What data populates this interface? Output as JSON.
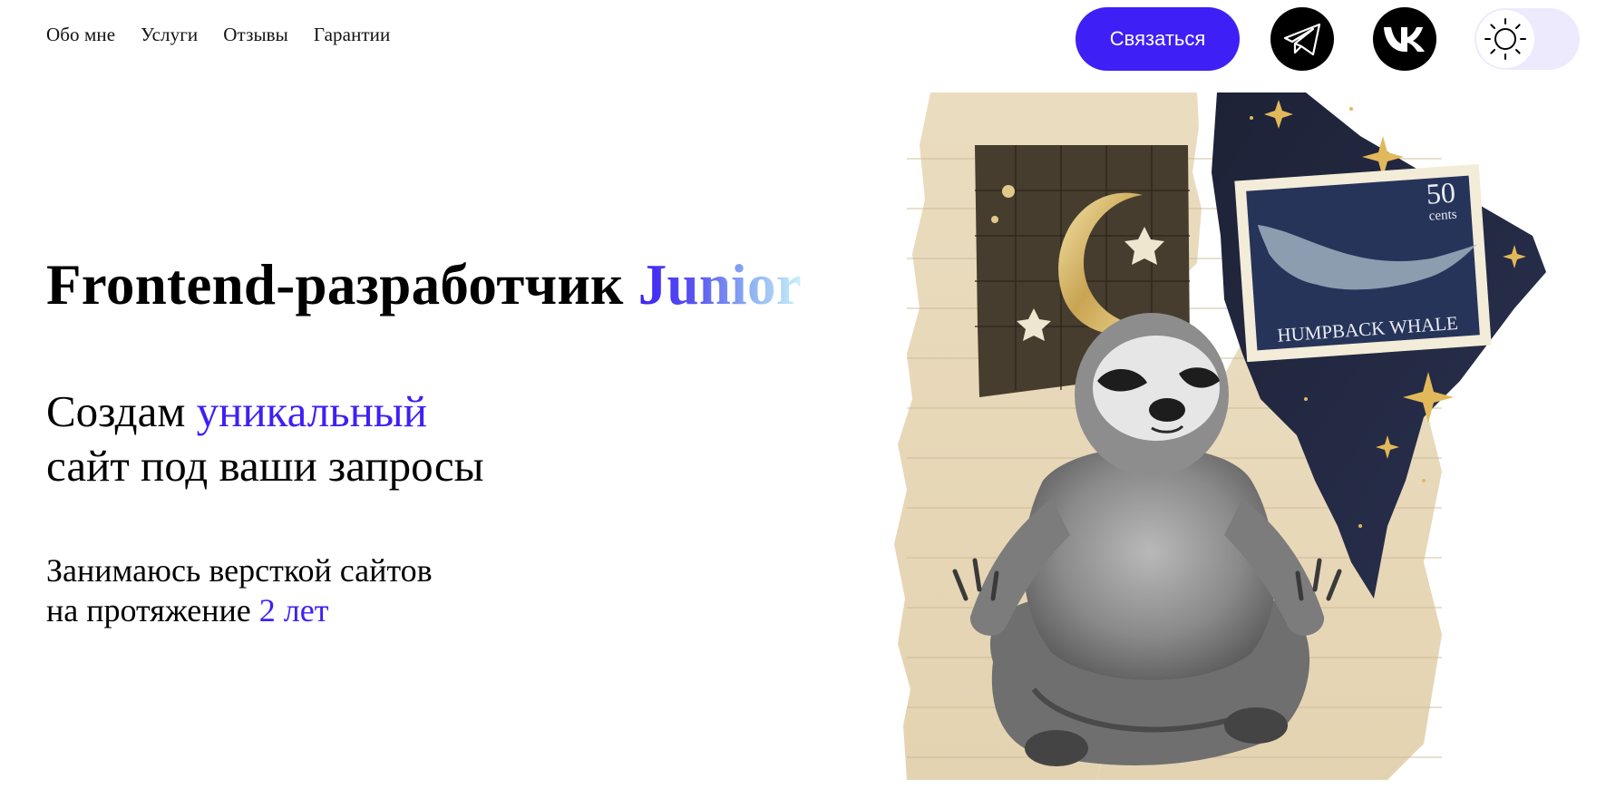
{
  "nav": {
    "items": [
      {
        "label": "Обо мне"
      },
      {
        "label": "Услуги"
      },
      {
        "label": "Отзывы"
      },
      {
        "label": "Гарантии"
      }
    ]
  },
  "header": {
    "contact_label": "Связаться",
    "accent_color": "#3e1ff6",
    "social": [
      {
        "name": "telegram-icon"
      },
      {
        "name": "vk-icon"
      }
    ],
    "theme_icon": "sun-icon"
  },
  "hero": {
    "title_main": "Frontend-разработчик ",
    "title_accent": "Junior",
    "sub_line1_plain": "Создам ",
    "sub_line1_accent": "уникальный",
    "sub_line2": "сайт под ваши запросы",
    "exp_line1": "Занимаюсь версткой сайтов",
    "exp_line2_plain": "на протяжение ",
    "exp_line2_accent": "2 лет"
  },
  "collage": {
    "stamp_value": "50",
    "stamp_unit": "cents",
    "stamp_caption": "HUMPBACK WHALE"
  }
}
